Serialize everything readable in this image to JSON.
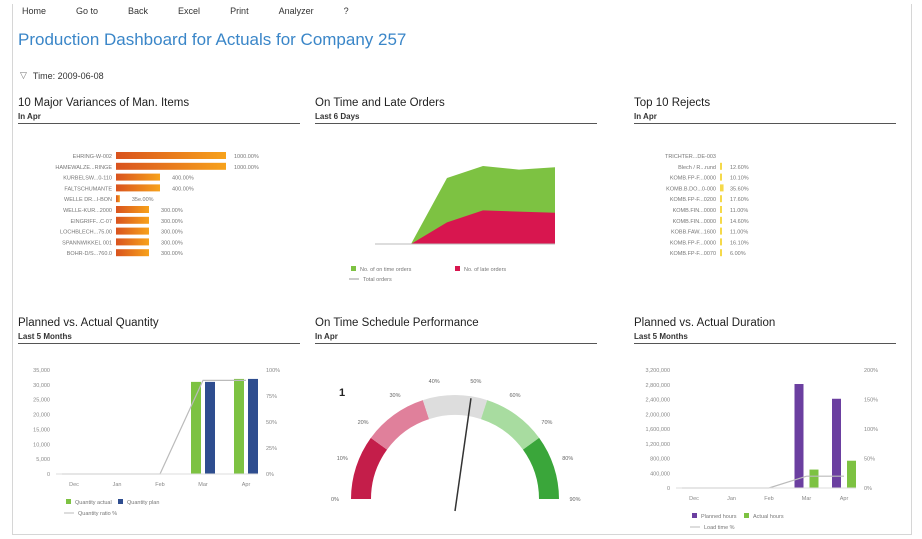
{
  "menu": [
    "Home",
    "Go to",
    "Back",
    "Excel",
    "Print",
    "Analyzer",
    "?"
  ],
  "title": "Production Dashboard for Actuals for Company 257",
  "time_filter": "Time: 2009-06-08",
  "panels": {
    "variances": {
      "title": "10 Major Variances of Man. Items",
      "subtitle": "In Apr"
    },
    "ontime_orders": {
      "title": "On Time and Late Orders",
      "subtitle": "Last 6 Days"
    },
    "rejects": {
      "title": "Top 10 Rejects",
      "subtitle": "In Apr"
    },
    "planned_qty": {
      "title": "Planned vs. Actual Quantity",
      "subtitle": "Last 5 Months"
    },
    "schedule": {
      "title": "On Time Schedule Performance",
      "subtitle": "In Apr",
      "gauge_number": "1"
    },
    "planned_duration": {
      "title": "Planned vs. Actual Duration",
      "subtitle": "Last 5 Months"
    }
  },
  "chart_data": [
    {
      "type": "bar",
      "id": "variances",
      "orientation": "horizontal",
      "categories": [
        "EHRING-W-002",
        "HAMEWALZE...RINGE",
        "KURBELSW...0-110",
        "FALTSCHUMANTE",
        "WELLE DR...I-BON",
        "WELLE-KUR...2000",
        "EINGRIFF...C-07",
        "LOCHBLECH...75.00",
        "SPANNWIKKEL 001",
        "BOHR-D/S...760.0"
      ],
      "values": [
        1000,
        1000,
        400,
        400,
        35,
        300,
        300,
        300,
        300,
        300
      ],
      "labels": [
        "1000.00%",
        "1000.00%",
        "400.00%",
        "400.00%",
        "35e.00%",
        "300.00%",
        "300.00%",
        "300.00%",
        "300.00%",
        "300.00%"
      ],
      "colors": [
        "#f7a21b",
        "#d9531e"
      ]
    },
    {
      "type": "area",
      "id": "ontime_orders",
      "x": [
        1,
        2,
        3,
        4,
        5,
        6
      ],
      "series": [
        {
          "name": "No. of on time orders",
          "values": [
            0,
            0,
            55,
            65,
            62,
            64
          ],
          "color": "#7dc242"
        },
        {
          "name": "No. of late orders",
          "values": [
            0,
            0,
            18,
            28,
            27,
            26
          ],
          "color": "#d8164f"
        }
      ],
      "line_series": {
        "name": "Total orders",
        "color": "#999999"
      }
    },
    {
      "type": "bar",
      "id": "rejects",
      "orientation": "horizontal",
      "categories": [
        "TRICHTER...DE-003",
        "Blech / R...rund",
        "KOMB.FP-F...0000",
        "KOMB.B.DO...0-000",
        "KOMB.FP-F...0200",
        "KOMB.FIN...0000",
        "KOMB.FIN...0000",
        "KOBB.FAW...1600",
        "KOMB.FP-F...0000",
        "KOMB.FP-F...0070"
      ],
      "values": [
        0,
        12.6,
        10.1,
        35.6,
        17.6,
        11.0,
        14.6,
        11.0,
        16.1,
        6.0
      ],
      "labels": [
        "",
        "12.60%",
        "10.10%",
        "35.60%",
        "17.60%",
        "11.00%",
        "14.60%",
        "11.00%",
        "16.10%",
        "6.00%"
      ],
      "color": "#f5d94a"
    },
    {
      "type": "bar",
      "id": "planned_qty",
      "categories": [
        "Dec",
        "Jan",
        "Feb",
        "Mar",
        "Apr"
      ],
      "ylim": [
        0,
        35000
      ],
      "y_ticks": [
        "35,000",
        "30,000",
        "25,000",
        "20,000",
        "15,000",
        "10,000",
        "5,000",
        "0"
      ],
      "y2_ticks": [
        "100%",
        "75%",
        "50%",
        "25%",
        "0%"
      ],
      "series": [
        {
          "name": "Quantity actual",
          "values": [
            0,
            0,
            0,
            31000,
            32000
          ],
          "color": "#7dc242"
        },
        {
          "name": "Quantity plan",
          "values": [
            0,
            0,
            0,
            31000,
            32000
          ],
          "color": "#2e4d8f"
        }
      ],
      "line_series": {
        "name": "Quantity ratio %",
        "values": [
          0,
          0,
          0,
          90,
          90
        ],
        "color": "#bbbbbb"
      }
    },
    {
      "type": "gauge",
      "id": "schedule",
      "value": 55,
      "tick_labels": [
        "0%",
        "10%",
        "20%",
        "30%",
        "40%",
        "50%",
        "60%",
        "70%",
        "80%",
        "90%"
      ],
      "colors": [
        "#c41e4a",
        "#e0809b",
        "#dddddd",
        "#a8dca0",
        "#3aa63a"
      ]
    },
    {
      "type": "bar",
      "id": "planned_duration",
      "categories": [
        "Dec",
        "Jan",
        "Feb",
        "Mar",
        "Apr"
      ],
      "ylim": [
        0,
        3200000
      ],
      "y_ticks": [
        "3,200,000",
        "2,800,000",
        "2,400,000",
        "2,000,000",
        "1,600,000",
        "1,200,000",
        "800,000",
        "400,000",
        "0"
      ],
      "y2_ticks": [
        "200%",
        "150%",
        "100%",
        "50%",
        "0%"
      ],
      "series": [
        {
          "name": "Planned hours",
          "values": [
            0,
            0,
            0,
            2820000,
            2420000
          ],
          "color": "#6b3fa0"
        },
        {
          "name": "Actual hours",
          "values": [
            0,
            0,
            0,
            500000,
            740000
          ],
          "color": "#7dc242"
        }
      ],
      "line_series": {
        "name": "Load time %",
        "values": [
          0,
          0,
          0,
          20,
          20
        ],
        "color": "#bbbbbb"
      }
    }
  ]
}
